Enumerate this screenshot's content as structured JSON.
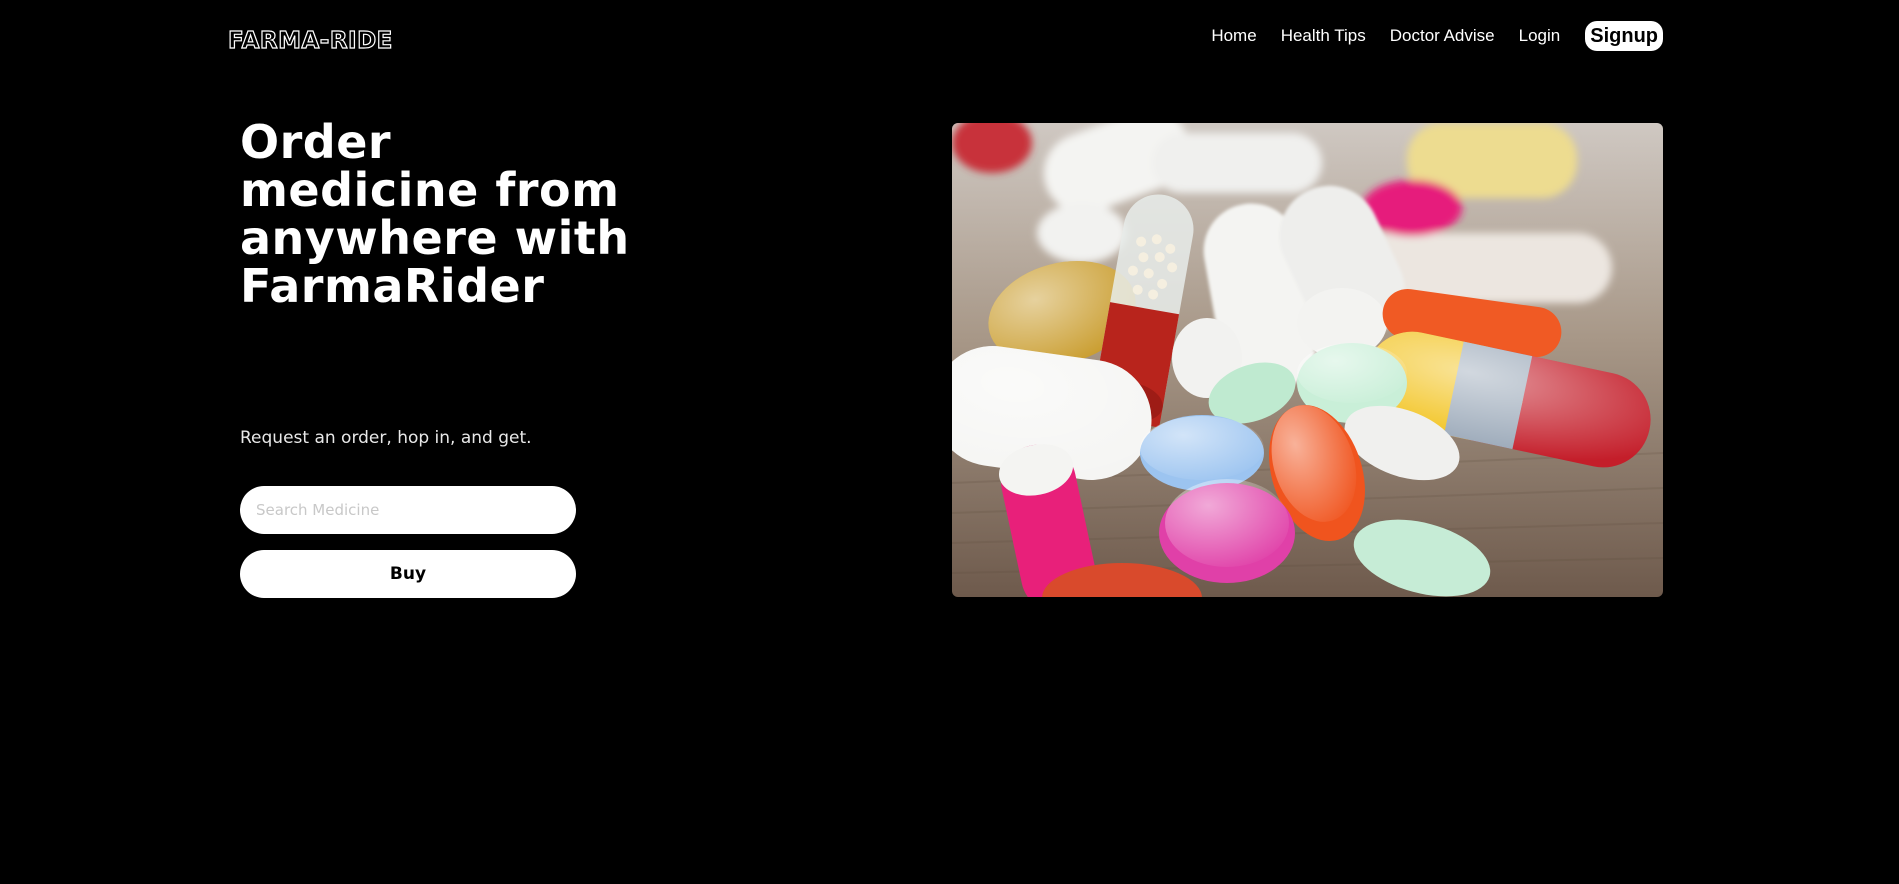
{
  "header": {
    "logo": "FARMA-RIDE",
    "nav": {
      "home": "Home",
      "health_tips": "Health Tips",
      "doctor_advise": "Doctor Advise",
      "login": "Login",
      "signup": "Signup"
    }
  },
  "hero": {
    "title": "Order medicine from anywhere with FarmaRider",
    "subtitle": "Request an order, hop in, and get.",
    "search": {
      "placeholder": "Search Medicine",
      "value": ""
    },
    "buy_label": "Buy"
  },
  "image": {
    "subject": "assorted pills and capsules on wooden table"
  }
}
